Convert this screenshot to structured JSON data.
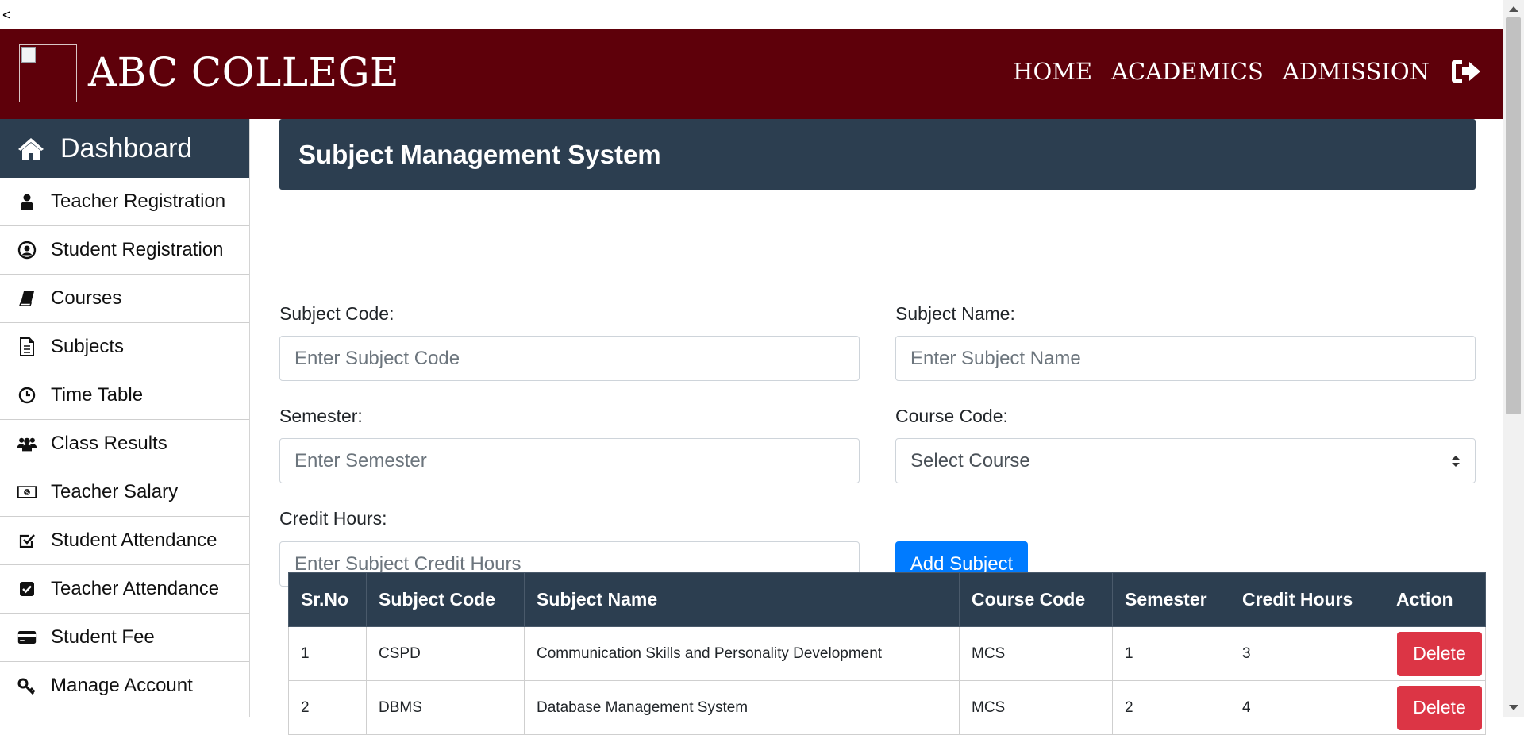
{
  "back": "<",
  "header": {
    "brand": "ABC COLLEGE",
    "nav": [
      "HOME",
      "ACADEMICS",
      "ADMISSION"
    ],
    "logout_icon": "sign-out-icon",
    "bg_color": "#5e000a"
  },
  "sidebar": {
    "dashboard": "Dashboard",
    "items": [
      {
        "label": "Teacher Registration",
        "icon": "user-icon"
      },
      {
        "label": "Student Registration",
        "icon": "user-circle-icon"
      },
      {
        "label": "Courses",
        "icon": "book-icon"
      },
      {
        "label": "Subjects",
        "icon": "file-text-icon"
      },
      {
        "label": "Time Table",
        "icon": "clock-icon"
      },
      {
        "label": "Class Results",
        "icon": "users-icon"
      },
      {
        "label": "Teacher Salary",
        "icon": "money-icon"
      },
      {
        "label": "Student Attendance",
        "icon": "check-square-icon"
      },
      {
        "label": "Teacher Attendance",
        "icon": "check-square-filled-icon"
      },
      {
        "label": "Student Fee",
        "icon": "credit-card-icon"
      },
      {
        "label": "Manage Account",
        "icon": "key-icon"
      }
    ]
  },
  "main": {
    "title": "Subject Management System",
    "form": {
      "subject_code_label": "Subject Code:",
      "subject_code_placeholder": "Enter Subject Code",
      "subject_name_label": "Subject Name:",
      "subject_name_placeholder": "Enter Subject Name",
      "semester_label": "Semester:",
      "semester_placeholder": "Enter Semester",
      "course_code_label": "Course Code:",
      "course_code_selected": "Select Course",
      "credit_hours_label": "Credit Hours:",
      "credit_hours_placeholder": "Enter Subject Credit Hours",
      "add_button": "Add Subject"
    },
    "table": {
      "headers": [
        "Sr.No",
        "Subject Code",
        "Subject Name",
        "Course Code",
        "Semester",
        "Credit Hours",
        "Action"
      ],
      "rows": [
        {
          "sr": "1",
          "code": "CSPD",
          "name": "Communication Skills and Personality Development",
          "course": "MCS",
          "semester": "1",
          "credit": "3",
          "action": "Delete"
        },
        {
          "sr": "2",
          "code": "DBMS",
          "name": "Database Management System",
          "course": "MCS",
          "semester": "2",
          "credit": "4",
          "action": "Delete"
        }
      ]
    }
  },
  "colors": {
    "header": "#5e000a",
    "panel": "#2c3e50",
    "primary": "#007bff",
    "danger": "#dc3545"
  }
}
